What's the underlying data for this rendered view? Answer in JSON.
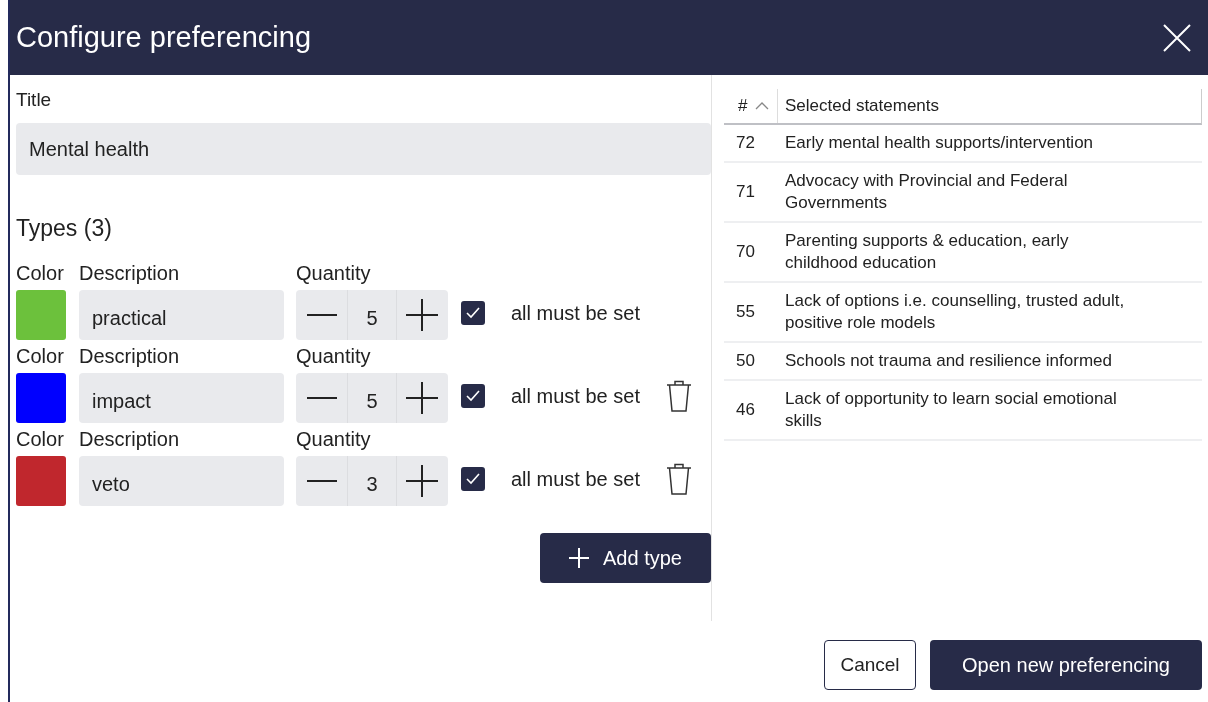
{
  "window": {
    "title": "Configure preferencing"
  },
  "title_field": {
    "label": "Title",
    "value": "Mental health"
  },
  "types_heading": "Types (3)",
  "types": [
    {
      "color": "#6cc13c",
      "color_label": "Color",
      "description_label": "Description",
      "quantity_label": "Quantity",
      "description": "practical",
      "quantity": "5",
      "all_must_be_set": true,
      "option_label": "all must be set",
      "deletable": false
    },
    {
      "color": "#0000ff",
      "color_label": "Color",
      "description_label": "Description",
      "quantity_label": "Quantity",
      "description": "impact",
      "quantity": "5",
      "all_must_be_set": true,
      "option_label": "all must be set",
      "deletable": true
    },
    {
      "color": "#c0272d",
      "color_label": "Color",
      "description_label": "Description",
      "quantity_label": "Quantity",
      "description": "veto",
      "quantity": "3",
      "all_must_be_set": true,
      "option_label": "all must be set",
      "deletable": true
    }
  ],
  "add_button": "Add type",
  "table": {
    "columns": [
      "#",
      "Selected statements"
    ],
    "rows": [
      {
        "number": "72",
        "statement": "Early mental health supports/intervention"
      },
      {
        "number": "71",
        "statement": "Advocacy with Provincial and Federal Governments"
      },
      {
        "number": "70",
        "statement": "Parenting supports & education, early childhood education"
      },
      {
        "number": "55",
        "statement": "Lack of options i.e. counselling, trusted adult, positive role models"
      },
      {
        "number": "50",
        "statement": "Schools not trauma and resilience informed"
      },
      {
        "number": "46",
        "statement": "Lack of opportunity to learn social emotional skills"
      }
    ]
  },
  "buttons": {
    "cancel": "Cancel",
    "confirm": "Open new preferencing"
  }
}
